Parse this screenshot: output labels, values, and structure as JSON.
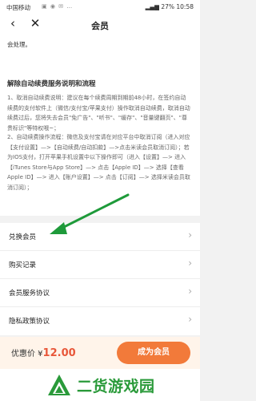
{
  "status_bar": {
    "carrier": "中国移动",
    "indicators": "▣ ◉ ✉ …",
    "battery": "27%",
    "time": "10:58"
  },
  "nav": {
    "back_icon": "‹",
    "close_icon": "✕",
    "title": "会员"
  },
  "notice": {
    "prev_text": "会处理。",
    "heading": "解除自动续费服务说明和流程",
    "para1": "1、取消自动续费说明：建议在每个续费周期到期前48小时，在签约自动续费的支付软件上（微信/支付宝/苹果支付）操作取消自动续费，取消自动续费过后，您将失去会员\"免广告\"、\"听书\"、\"缓存\"、\"音量键翻页\"、\"尊贵标识\"等特权哦~；",
    "para2": "2、自动续费操作流程：微信及支付宝请在对应平台中取消订阅（进入对应【支付设置】—>【自动续费/自动扣款】—>点击米读会员取消订阅）；若为IOS支付，打开苹果手机设置中以下操作即可（进入【设置】—> 进入【iTunes Store与App Store】—> 点击【Apple ID】—> 选择【查看Apple ID】—> 进入【账户设置】—> 点击【订阅】—> 选择米读会员取消订阅）；"
  },
  "menu": {
    "items": [
      {
        "label": "兑换会员"
      },
      {
        "label": "购买记录"
      },
      {
        "label": "会员服务协议"
      },
      {
        "label": "隐私政策协议"
      }
    ],
    "chevron": "›"
  },
  "bottom": {
    "price_prefix": "优惠价 ¥",
    "price_value": "12.00",
    "cta_label": "成为会员"
  },
  "footer": {
    "brand": "二货游戏园"
  },
  "colors": {
    "arrow": "#1e9a3a",
    "accent": "#f27a3a",
    "brand": "#2a9a3a"
  }
}
